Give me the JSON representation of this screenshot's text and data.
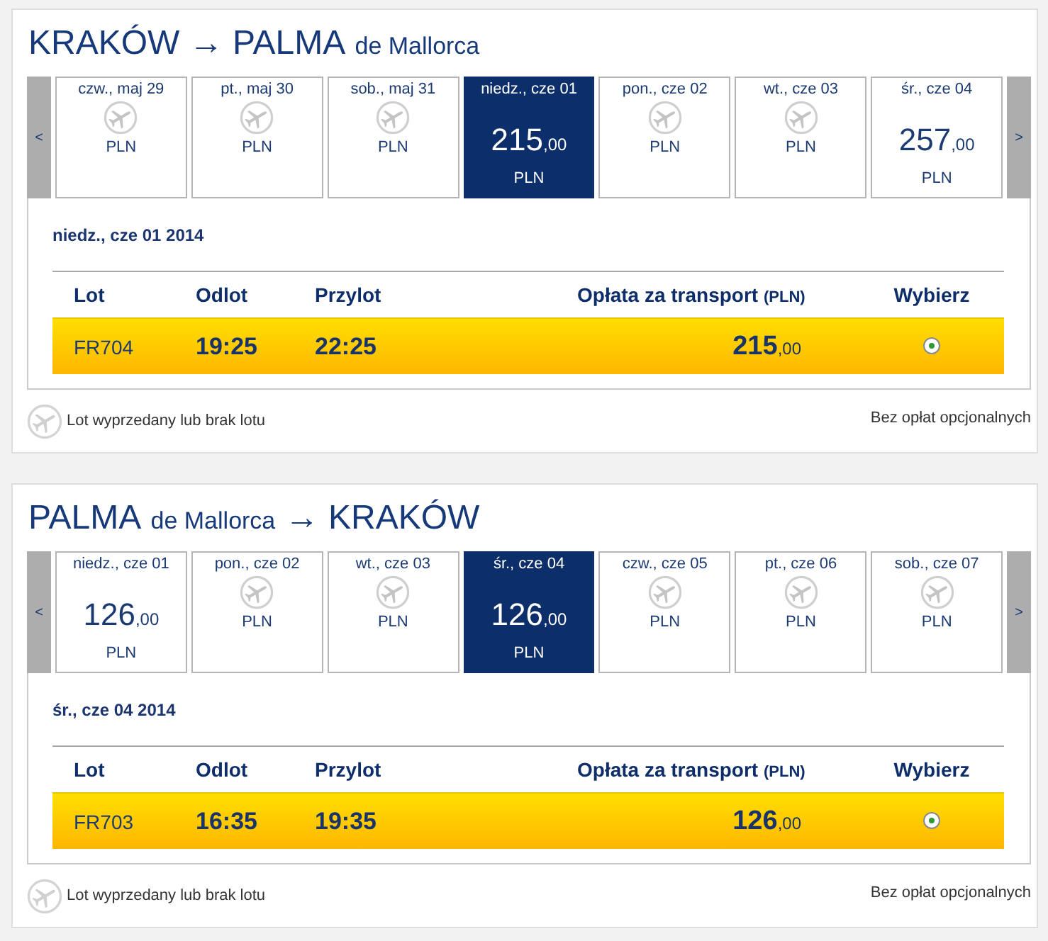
{
  "journeys": [
    {
      "title": [
        {
          "text": "KRAKÓW → PALMA",
          "kind": "main"
        },
        {
          "text": "de Mallorca",
          "kind": "minor"
        }
      ],
      "prev_label": "<",
      "next_label": ">",
      "days": [
        {
          "date": "czw., maj 29",
          "kind": "no-flight",
          "currency": "PLN",
          "selected": false
        },
        {
          "date": "pt., maj 30",
          "kind": "no-flight",
          "currency": "PLN",
          "selected": false
        },
        {
          "date": "sob., maj 31",
          "kind": "no-flight",
          "currency": "PLN",
          "selected": false
        },
        {
          "date": "niedz., cze 01",
          "kind": "fare",
          "amount": "215",
          "fraction": ",00",
          "currency": "PLN",
          "selected": true
        },
        {
          "date": "pon., cze 02",
          "kind": "no-flight",
          "currency": "PLN",
          "selected": false
        },
        {
          "date": "wt., cze 03",
          "kind": "no-flight",
          "currency": "PLN",
          "selected": false
        },
        {
          "date": "śr., cze 04",
          "kind": "fare",
          "amount": "257",
          "fraction": ",00",
          "currency": "PLN",
          "selected": false
        }
      ],
      "selected_date": "niedz., cze 01 2014",
      "table": {
        "columns": [
          {
            "label": "Lot"
          },
          {
            "label": "Odlot"
          },
          {
            "label": "Przylot"
          },
          {
            "label": "Opłata za transport",
            "unit": "(PLN)"
          },
          {
            "label": "Wybierz"
          }
        ],
        "rows": [
          {
            "flight": "FR704",
            "departure": "19:25",
            "arrival": "22:25",
            "fare": "215",
            "fare_fraction": ",00",
            "selected": true
          }
        ]
      },
      "legend": "Lot wyprzedany lub brak lotu",
      "note": "Bez opłat opcjonalnych"
    },
    {
      "title": [
        {
          "text": "PALMA",
          "kind": "main"
        },
        {
          "text": "de Mallorca",
          "kind": "minor"
        },
        {
          "text": "→ KRAKÓW",
          "kind": "main"
        }
      ],
      "prev_label": "<",
      "next_label": ">",
      "days": [
        {
          "date": "niedz., cze 01",
          "kind": "fare",
          "amount": "126",
          "fraction": ",00",
          "currency": "PLN",
          "selected": false
        },
        {
          "date": "pon., cze 02",
          "kind": "no-flight",
          "currency": "PLN",
          "selected": false
        },
        {
          "date": "wt., cze 03",
          "kind": "no-flight",
          "currency": "PLN",
          "selected": false
        },
        {
          "date": "śr., cze 04",
          "kind": "fare",
          "amount": "126",
          "fraction": ",00",
          "currency": "PLN",
          "selected": true
        },
        {
          "date": "czw., cze 05",
          "kind": "no-flight",
          "currency": "PLN",
          "selected": false
        },
        {
          "date": "pt., cze 06",
          "kind": "no-flight",
          "currency": "PLN",
          "selected": false
        },
        {
          "date": "sob., cze 07",
          "kind": "no-flight",
          "currency": "PLN",
          "selected": false
        }
      ],
      "selected_date": "śr., cze 04 2014",
      "table": {
        "columns": [
          {
            "label": "Lot"
          },
          {
            "label": "Odlot"
          },
          {
            "label": "Przylot"
          },
          {
            "label": "Opłata za transport",
            "unit": "(PLN)"
          },
          {
            "label": "Wybierz"
          }
        ],
        "rows": [
          {
            "flight": "FR703",
            "departure": "16:35",
            "arrival": "19:35",
            "fare": "126",
            "fare_fraction": ",00",
            "selected": true
          }
        ]
      },
      "legend": "Lot wyprzedany lub brak lotu",
      "note": "Bez opłat opcjonalnych"
    }
  ]
}
